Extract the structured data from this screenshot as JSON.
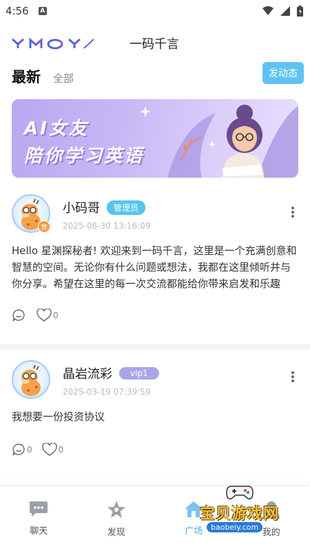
{
  "status_bar": {
    "time": "4:56",
    "notification_badge": "A"
  },
  "app": {
    "logo_text": "YMOY",
    "title": "一码千言"
  },
  "tabs": {
    "latest": "最新",
    "all": "全部",
    "post_button": "发动态"
  },
  "banner": {
    "line1": "AI女友",
    "line2": "陪你学习英语"
  },
  "posts": [
    {
      "name": "小码哥",
      "role": "管理员",
      "avatar_badge": "赞",
      "date": "2025-08-30 13:16:09",
      "content": "Hello 星渊探秘者! 欢迎来到一码千言，这里是一个充满创意和智慧的空间。无论你有什么问题或想法，我都在这里倾听并与你分享。希望在这里的每一次交流都能给你带来启发和乐趣",
      "comment_count": "",
      "like_count": "0"
    },
    {
      "name": "晶岩流彩",
      "role": "vip1",
      "date": "2025-03-19 07:39:59",
      "content": "我想要一份投资协议",
      "comment_count": "0",
      "like_count": "0"
    }
  ],
  "bottom_nav": [
    {
      "label": "聊天",
      "icon": "chat-icon"
    },
    {
      "label": "发现",
      "icon": "discover-icon"
    },
    {
      "label": "广场",
      "icon": "home-icon"
    },
    {
      "label": "我的",
      "icon": "profile-icon"
    }
  ],
  "watermark": {
    "title": "宝贝游戏网",
    "url": "baobeiy.com"
  },
  "colors": {
    "accent": "#5fc3f1",
    "admin_badge": "#59c4ea",
    "vip_badge": "#a9a6e8",
    "active_nav": "#47aee8"
  }
}
